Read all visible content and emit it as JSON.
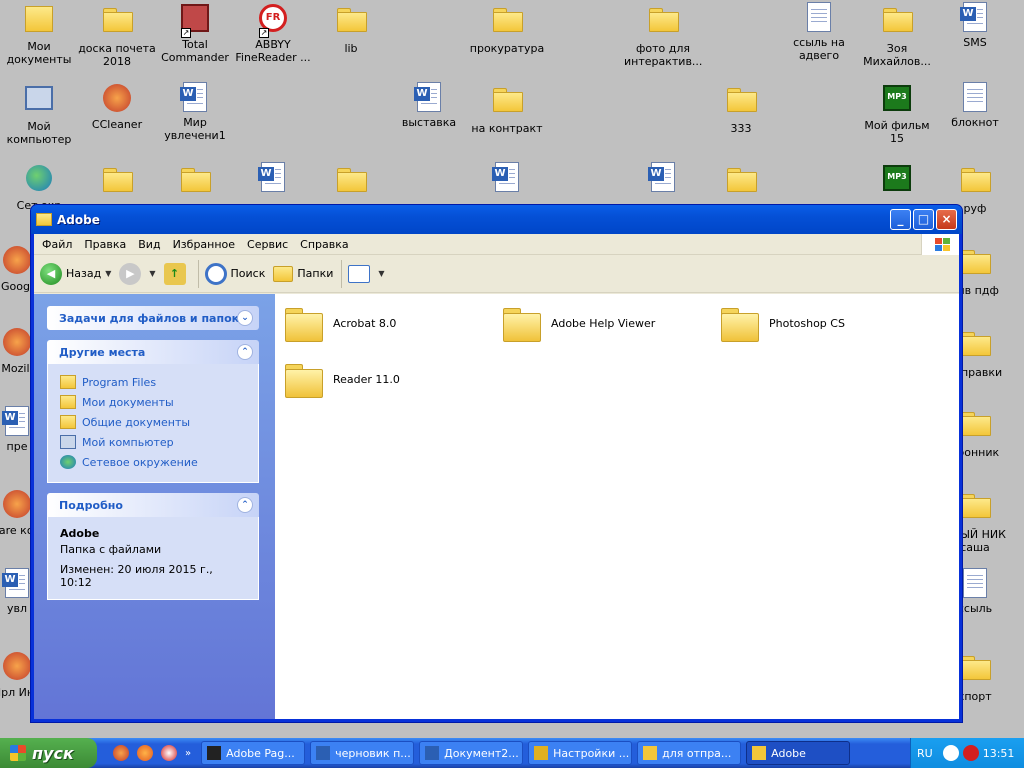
{
  "desktop": {
    "icons": [
      {
        "label": "Мои документы",
        "kind": "mydocs"
      },
      {
        "label": "доска почета 2018",
        "kind": "folder"
      },
      {
        "label": "Total Commander",
        "kind": "tc"
      },
      {
        "label": "ABBYY FineReader ...",
        "kind": "abbyy"
      },
      {
        "label": "lib",
        "kind": "folder"
      },
      {
        "label": "прокуратура",
        "kind": "folder"
      },
      {
        "label": "фото для интерактив...",
        "kind": "folder"
      },
      {
        "label": "ссыль на адвего",
        "kind": "doc"
      },
      {
        "label": "Зоя Михайлов...",
        "kind": "folder"
      },
      {
        "label": "SMS",
        "kind": "word"
      },
      {
        "label": "Мой компьютер",
        "kind": "pc"
      },
      {
        "label": "CCleaner",
        "kind": "gear"
      },
      {
        "label": "Мир увлечени1",
        "kind": "word"
      },
      {
        "label": "выставка",
        "kind": "word"
      },
      {
        "label": "на контракт",
        "kind": "folder"
      },
      {
        "label": "333",
        "kind": "folder"
      },
      {
        "label": "Мой фильм 15",
        "kind": "mp3"
      },
      {
        "label": "блокнот",
        "kind": "doc"
      },
      {
        "label": "Сет окр",
        "kind": "net"
      },
      {
        "label": "",
        "kind": "folder"
      },
      {
        "label": "",
        "kind": "folder"
      },
      {
        "label": "",
        "kind": "word"
      },
      {
        "label": "",
        "kind": "folder"
      },
      {
        "label": "",
        "kind": "word"
      },
      {
        "label": "",
        "kind": "word"
      },
      {
        "label": "",
        "kind": "folder"
      },
      {
        "label": "",
        "kind": "mp3"
      },
      {
        "label": "руф",
        "kind": "folder"
      },
      {
        "label": "Googl",
        "kind": "gear"
      },
      {
        "label": "тив пдф",
        "kind": "folder"
      },
      {
        "label": "Mozill",
        "kind": "gear"
      },
      {
        "label": "отправки",
        "kind": "folder"
      },
      {
        "label": "пре",
        "kind": "word"
      },
      {
        "label": "тронник",
        "kind": "folder"
      },
      {
        "label": "Share комп",
        "kind": "gear"
      },
      {
        "label": "ОВЫЙ НИК саша",
        "kind": "folder"
      },
      {
        "label": "увл",
        "kind": "word"
      },
      {
        "label": "ссыль",
        "kind": "doc"
      },
      {
        "label": "Ярл Инт",
        "kind": "gear"
      },
      {
        "label": "спорт",
        "kind": "folder"
      }
    ],
    "mp3_badge": "MP3",
    "word_badge": "W"
  },
  "window": {
    "title": "Adobe",
    "menu": [
      "Файл",
      "Правка",
      "Вид",
      "Избранное",
      "Сервис",
      "Справка"
    ],
    "toolbar": {
      "back_label": "Назад",
      "search_label": "Поиск",
      "folders_label": "Папки"
    },
    "left": {
      "tasks_title": "Задачи для файлов и папок",
      "places_title": "Другие места",
      "places": [
        {
          "label": "Program Files",
          "icon": "folder-icon"
        },
        {
          "label": "Мои документы",
          "icon": "folder-icon"
        },
        {
          "label": "Общие документы",
          "icon": "folder-icon"
        },
        {
          "label": "Мой компьютер",
          "icon": "computer-icon"
        },
        {
          "label": "Сетевое окружение",
          "icon": "network-icon"
        }
      ],
      "details_title": "Подробно",
      "details_name": "Adobe",
      "details_type": "Папка с файлами",
      "details_modified": "Изменен: 20 июля 2015 г., 10:12"
    },
    "folders": [
      "Acrobat 8.0",
      "Adobe Help Viewer",
      "Photoshop CS",
      "Reader 11.0"
    ]
  },
  "taskbar": {
    "start_label": "пуск",
    "tasks": [
      {
        "label": "Adobe Pag..."
      },
      {
        "label": "черновик п..."
      },
      {
        "label": "Документ2..."
      },
      {
        "label": "Настройки ..."
      },
      {
        "label": "для отпра..."
      },
      {
        "label": "Adobe"
      }
    ],
    "lang": "RU",
    "clock": "13:51"
  },
  "colors": {
    "desktop_bg": "#c0c0c0",
    "title_blue": "#0550d6",
    "taskbar_blue": "#245edb",
    "start_green": "#3c8a35",
    "link_blue": "#215dc6"
  }
}
